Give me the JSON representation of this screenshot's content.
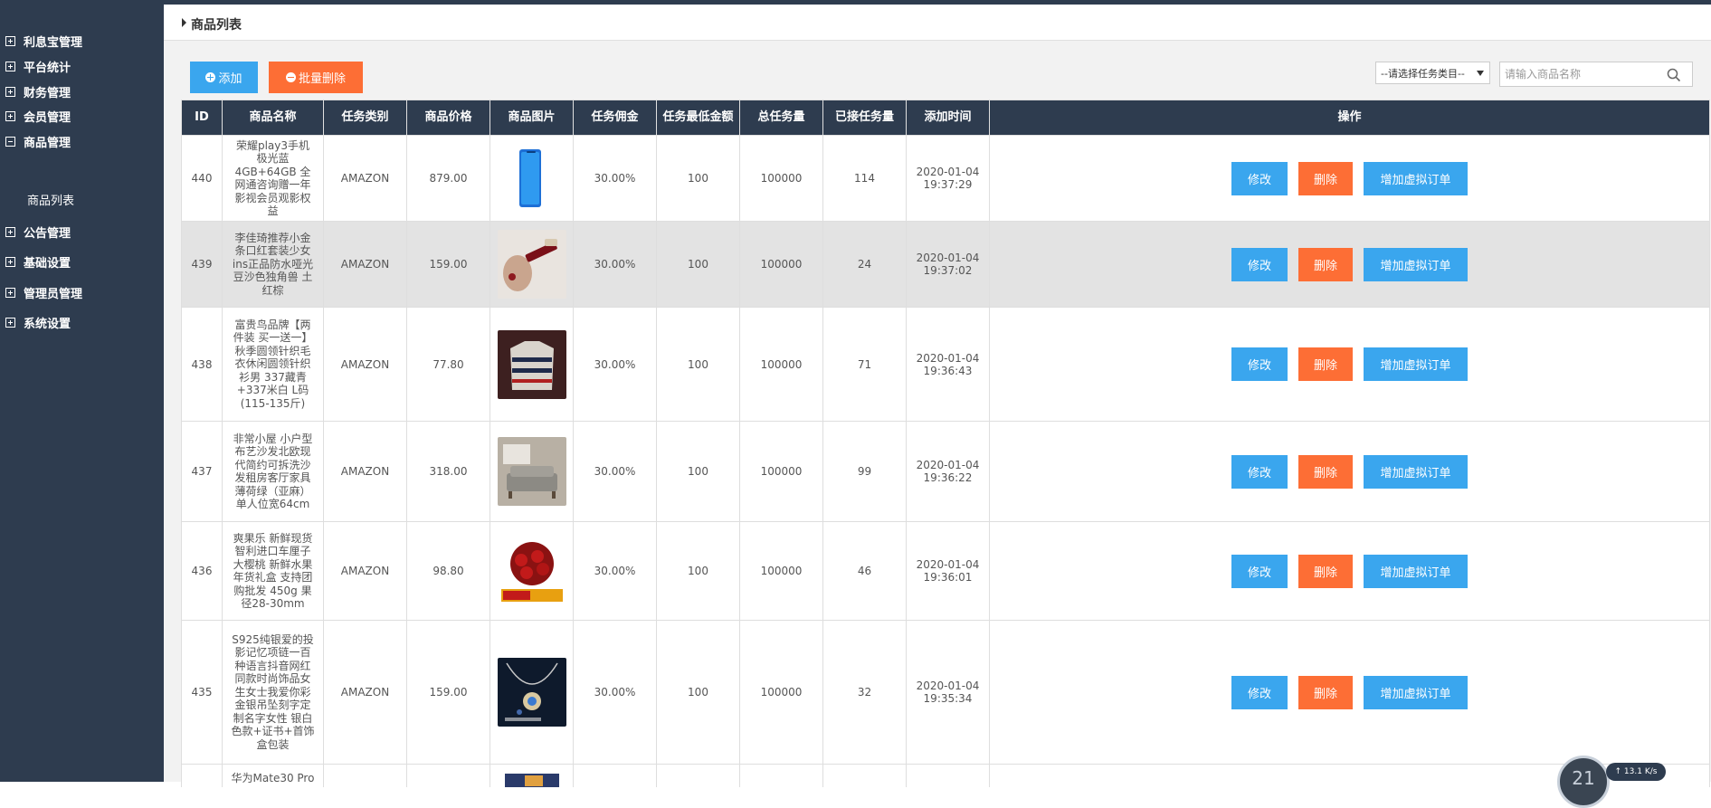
{
  "sidebar": {
    "items": [
      {
        "label": "利息宝管理",
        "expanded": false
      },
      {
        "label": "平台统计",
        "expanded": false
      },
      {
        "label": "财务管理",
        "expanded": false
      },
      {
        "label": "会员管理",
        "expanded": false
      },
      {
        "label": "商品管理",
        "expanded": true,
        "children": [
          {
            "label": "商品列表"
          }
        ]
      },
      {
        "label": "公告管理",
        "expanded": false
      },
      {
        "label": "基础设置",
        "expanded": false
      },
      {
        "label": "管理员管理",
        "expanded": false
      },
      {
        "label": "系统设置",
        "expanded": false
      }
    ]
  },
  "header": {
    "title": "商品列表"
  },
  "toolbar": {
    "add_label": "添加",
    "batch_delete_label": "批量删除",
    "category_select": "--请选择任务类目--",
    "search_placeholder": "请输入商品名称"
  },
  "table": {
    "columns": [
      "ID",
      "商品名称",
      "任务类别",
      "商品价格",
      "商品图片",
      "任务佣金",
      "任务最低金额",
      "总任务量",
      "已接任务量",
      "添加时间",
      "操作"
    ],
    "rows": [
      {
        "id": "440",
        "name": "荣耀play3手机 极光蓝 4GB+64GB 全网通咨询赠一年影视会员观影权益",
        "category": "AMAZON",
        "price": "879.00",
        "image": "phone",
        "commission": "30.00%",
        "min_amount": "100",
        "total": "100000",
        "taken": "114",
        "time": "2020-01-04 19:37:29"
      },
      {
        "id": "439",
        "name": "李佳琦推荐小金条口红套装少女ins正品防水哑光豆沙色独角兽 土红棕",
        "category": "AMAZON",
        "price": "159.00",
        "image": "lipstick",
        "commission": "30.00%",
        "min_amount": "100",
        "total": "100000",
        "taken": "24",
        "time": "2020-01-04 19:37:02"
      },
      {
        "id": "438",
        "name": "富贵鸟品牌【两件装 买一送一】秋季圆领针织毛衣休闲圆领针织衫男 337藏青+337米白 L码(115-135斤)",
        "category": "AMAZON",
        "price": "77.80",
        "image": "sweater",
        "commission": "30.00%",
        "min_amount": "100",
        "total": "100000",
        "taken": "71",
        "time": "2020-01-04 19:36:43"
      },
      {
        "id": "437",
        "name": "非常小屋 小户型布艺沙发北欧现代简约可拆洗沙发租房客厅家具 薄荷绿（亚麻）单人位宽64cm",
        "category": "AMAZON",
        "price": "318.00",
        "image": "sofa",
        "commission": "30.00%",
        "min_amount": "100",
        "total": "100000",
        "taken": "99",
        "time": "2020-01-04 19:36:22"
      },
      {
        "id": "436",
        "name": "爽果乐 新鲜现货智利进口车厘子大樱桃 新鲜水果年货礼盒 支持团购批发 450g 果径28-30mm",
        "category": "AMAZON",
        "price": "98.80",
        "image": "cherry",
        "commission": "30.00%",
        "min_amount": "100",
        "total": "100000",
        "taken": "46",
        "time": "2020-01-04 19:36:01"
      },
      {
        "id": "435",
        "name": "S925纯银爱的投影记忆项链一百种语言抖音网红同款时尚饰品女生女士我爱你彩金银吊坠刻字定制名字女性 银白色款+证书+首饰盒包装",
        "category": "AMAZON",
        "price": "159.00",
        "image": "necklace",
        "commission": "30.00%",
        "min_amount": "100",
        "total": "100000",
        "taken": "32",
        "time": "2020-01-04 19:35:34"
      },
      {
        "id": "",
        "name": "华为Mate30 Pro",
        "category": "",
        "price": "",
        "image": "mate30",
        "commission": "",
        "min_amount": "",
        "total": "",
        "taken": "",
        "time": ""
      }
    ],
    "actions": {
      "edit": "修改",
      "delete": "删除",
      "virtual_order": "增加虚拟订单"
    }
  },
  "network_widget": {
    "number": "21",
    "speed": "↑ 13.1 K/s"
  },
  "colors": {
    "sidebar": "#2e3c4f",
    "primary": "#3aa6ee",
    "danger": "#fd6e35",
    "table_header": "#2e3c4f"
  }
}
